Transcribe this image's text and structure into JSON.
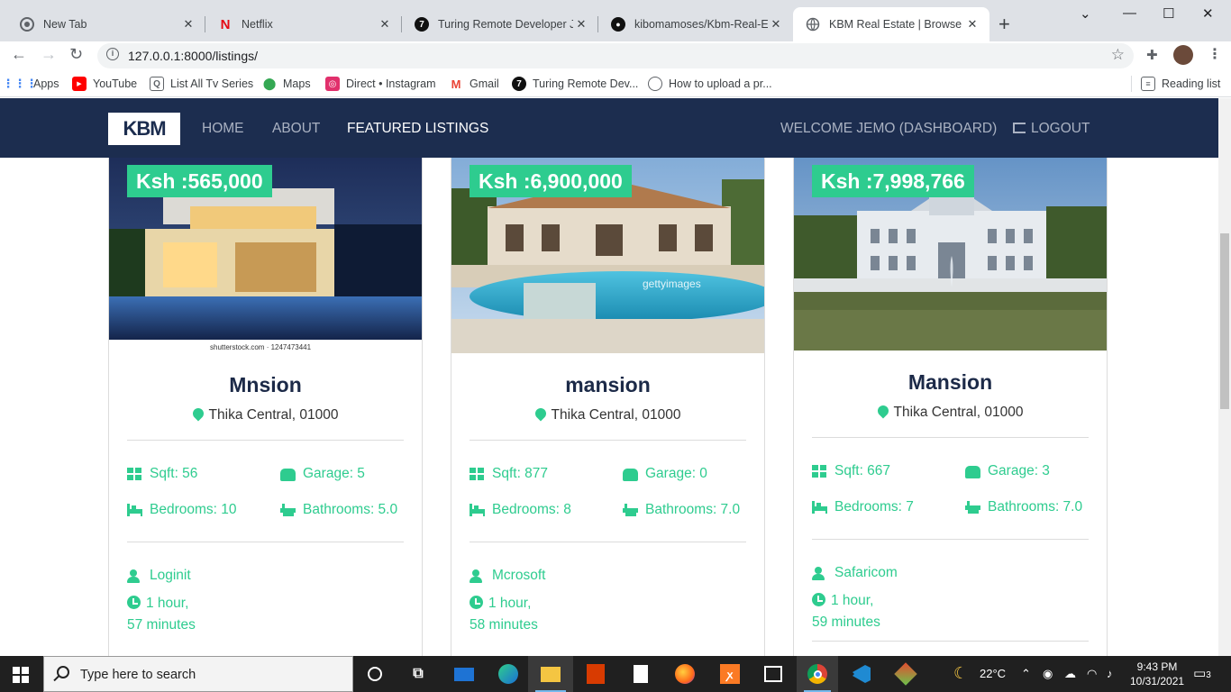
{
  "browser": {
    "tabs": [
      {
        "title": "New Tab",
        "icon": "chrome-icon"
      },
      {
        "title": "Netflix",
        "icon": "netflix-icon"
      },
      {
        "title": "Turing Remote Developer Jobs",
        "icon": "turing-icon"
      },
      {
        "title": "kibomamoses/Kbm-Real-Estate",
        "icon": "github-icon"
      },
      {
        "title": "KBM Real Estate | Browse Properties",
        "icon": "globe-icon"
      }
    ],
    "url": "127.0.0.1:8000/listings/",
    "bookmarks": [
      {
        "label": "Apps",
        "icon": "apps-grid-icon",
        "color": "#4285f4"
      },
      {
        "label": "YouTube",
        "icon": "youtube-icon",
        "color": "#ff0000"
      },
      {
        "label": "List All Tv Series",
        "icon": "tv-icon",
        "color": "#5f6368"
      },
      {
        "label": "Maps",
        "icon": "maps-pin-icon",
        "color": "#34a853"
      },
      {
        "label": "Direct • Instagram",
        "icon": "instagram-icon",
        "color": "#e1306c"
      },
      {
        "label": "Gmail",
        "icon": "gmail-icon",
        "color": "#ea4335"
      },
      {
        "label": "Turing Remote Dev...",
        "icon": "turing-icon",
        "color": "#111111"
      },
      {
        "label": "How to upload a pr...",
        "icon": "globe-icon",
        "color": "#5f6368"
      }
    ],
    "reading_list": "Reading list"
  },
  "site": {
    "logo_text": "KBM",
    "nav": {
      "home": "HOME",
      "about": "ABOUT",
      "featured": "FEATURED LISTINGS",
      "welcome": "WELCOME JEMO (DASHBOARD)",
      "logout": "LOGOUT"
    },
    "colors": {
      "navbar": "#1c2d4f",
      "accent": "#2ecc8f",
      "title": "#1c2a48"
    },
    "listings": [
      {
        "price": "Ksh :565,000",
        "title": "Mnsion",
        "location": "Thika Central, 01000",
        "sqft": "Sqft: 56",
        "garage": "Garage: 5",
        "bedrooms": "Bedrooms: 10",
        "bathrooms": "Bathrooms: 5.0",
        "realtor": "Loginit",
        "time_line1": "1 hour,",
        "time_line2": "57 minutes",
        "photo_caption": "shutterstock.com · 1247473441"
      },
      {
        "price": "Ksh :6,900,000",
        "title": "mansion",
        "location": "Thika Central, 01000",
        "sqft": "Sqft: 877",
        "garage": "Garage: 0",
        "bedrooms": "Bedrooms: 8",
        "bathrooms": "Bathrooms: 7.0",
        "realtor": "Mcrosoft",
        "time_line1": "1 hour,",
        "time_line2": "58 minutes",
        "photo_caption": "gettyimages"
      },
      {
        "price": "Ksh :7,998,766",
        "title": "Mansion",
        "location": "Thika Central, 01000",
        "sqft": "Sqft: 667",
        "garage": "Garage: 3",
        "bedrooms": "Bedrooms: 7",
        "bathrooms": "Bathrooms: 7.0",
        "realtor": "Safaricom",
        "time_line1": "1 hour,",
        "time_line2": "59 minutes"
      }
    ]
  },
  "taskbar": {
    "search_placeholder": "Type here to search",
    "weather": "22°C",
    "time": "9:43 PM",
    "date": "10/31/2021",
    "notifications": "3"
  }
}
